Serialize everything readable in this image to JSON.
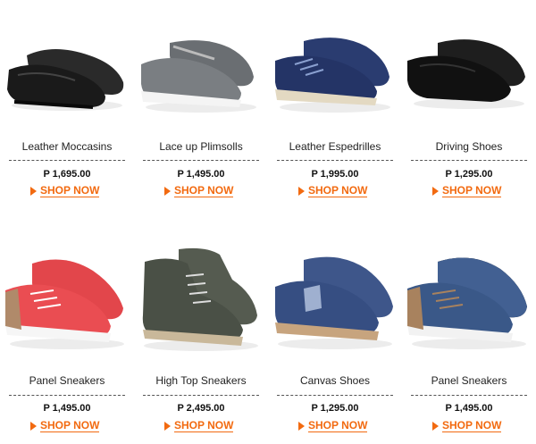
{
  "products": [
    {
      "name": "Leather Moccasins",
      "price": "P 1,695.00",
      "cta": "SHOP NOW",
      "icon": "leather-moccasins-image",
      "color": "#1c1c1c"
    },
    {
      "name": "Lace up Plimsolls",
      "price": "P 1,495.00",
      "cta": "SHOP NOW",
      "icon": "plimsolls-image",
      "color": "#6e7276"
    },
    {
      "name": "Leather Espedrilles",
      "price": "P 1,995.00",
      "cta": "SHOP NOW",
      "icon": "espadrilles-image",
      "color": "#26386a"
    },
    {
      "name": "Driving Shoes",
      "price": "P 1,295.00",
      "cta": "SHOP NOW",
      "icon": "driving-shoes-image",
      "color": "#151515"
    },
    {
      "name": "Panel Sneakers",
      "price": "P 1,495.00",
      "cta": "SHOP NOW",
      "icon": "red-sneakers-image",
      "color": "#e8474b"
    },
    {
      "name": "High Top Sneakers",
      "price": "P 2,495.00",
      "cta": "SHOP NOW",
      "icon": "high-top-sneakers-image",
      "color": "#4b5147"
    },
    {
      "name": "Canvas Shoes",
      "price": "P 1,295.00",
      "cta": "SHOP NOW",
      "icon": "canvas-shoes-image",
      "color": "#3a5286"
    },
    {
      "name": "Panel Sneakers",
      "price": "P 1,495.00",
      "cta": "SHOP NOW",
      "icon": "blue-sneakers-image",
      "color": "#3c5888"
    }
  ],
  "theme": {
    "accent": "#f26a10",
    "text": "#222222"
  }
}
